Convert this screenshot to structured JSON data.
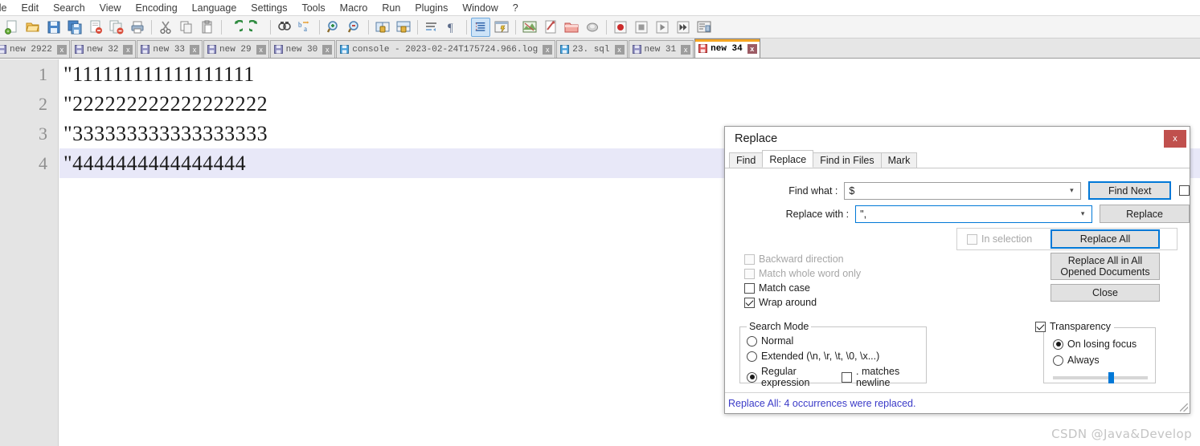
{
  "app": {
    "name": "Notepad++"
  },
  "menubar": {
    "items": [
      {
        "label": "ile"
      },
      {
        "label": "Edit"
      },
      {
        "label": "Search"
      },
      {
        "label": "View"
      },
      {
        "label": "Encoding"
      },
      {
        "label": "Language"
      },
      {
        "label": "Settings"
      },
      {
        "label": "Tools"
      },
      {
        "label": "Macro"
      },
      {
        "label": "Run"
      },
      {
        "label": "Plugins"
      },
      {
        "label": "Window"
      },
      {
        "label": "?"
      }
    ]
  },
  "toolbar": {
    "icons": [
      "new-file-icon",
      "open-file-icon",
      "save-icon",
      "save-all-icon",
      "close-file-icon",
      "close-all-files-icon",
      "print-icon",
      "cut-icon",
      "copy-icon",
      "paste-icon",
      "undo-icon",
      "redo-icon",
      "find-icon",
      "replace-icon",
      "zoom-in-icon",
      "zoom-out-icon",
      "sync-vertical-scroll-icon",
      "sync-horizontal-scroll-icon",
      "word-wrap-icon",
      "show-all-characters-icon",
      "indent-guide-icon",
      "user-defined-dialog-icon",
      "show-document-map-icon",
      "function-list-icon",
      "folder-as-workspace-icon",
      "monitoring-icon",
      "record-macro-icon",
      "stop-recording-icon",
      "play-macro-icon",
      "run-macro-multiple-icon",
      "run-icon"
    ]
  },
  "tabs": {
    "items": [
      {
        "label": "new 2922",
        "active": false
      },
      {
        "label": "new 32",
        "active": false
      },
      {
        "label": "new 33",
        "active": false
      },
      {
        "label": "new 29",
        "active": false
      },
      {
        "label": "new 30",
        "active": false
      },
      {
        "label": "console - 2023-02-24T175724.966.log",
        "active": false
      },
      {
        "label": "23. sql",
        "active": false
      },
      {
        "label": "new 31",
        "active": false
      },
      {
        "label": "new 34",
        "active": true
      }
    ],
    "close_glyph": "x"
  },
  "editor": {
    "lines": [
      {
        "number": "1",
        "text": "\"111111111111111111",
        "highlighted": false
      },
      {
        "number": "2",
        "text": "\"222222222222222222",
        "highlighted": false
      },
      {
        "number": "3",
        "text": "\"333333333333333333",
        "highlighted": false
      },
      {
        "number": "4",
        "text": "\"4444444444444444",
        "highlighted": true
      }
    ]
  },
  "dialog": {
    "title": "Replace",
    "close_label": "x",
    "tabs": [
      {
        "label": "Find",
        "active": false
      },
      {
        "label": "Replace",
        "active": true
      },
      {
        "label": "Find in Files",
        "active": false
      },
      {
        "label": "Mark",
        "active": false
      }
    ],
    "fields": {
      "find_what_label": "Find what :",
      "find_what_value": "$",
      "replace_with_label": "Replace with :",
      "replace_with_value": "\",",
      "arrow_glyph": "⌄"
    },
    "buttons": {
      "find_next": "Find Next",
      "replace": "Replace",
      "replace_all": "Replace All",
      "replace_all_opened": "Replace All in All Opened Documents",
      "close": "Close"
    },
    "in_selection": {
      "label": "In selection",
      "checked": false,
      "enabled": false
    },
    "options": [
      {
        "label": "Backward direction",
        "checked": false,
        "enabled": false
      },
      {
        "label": "Match whole word only",
        "checked": false,
        "enabled": false
      },
      {
        "label": "Match case",
        "checked": false,
        "enabled": true
      },
      {
        "label": "Wrap around",
        "checked": true,
        "enabled": true
      }
    ],
    "search_mode": {
      "legend": "Search Mode",
      "options": [
        {
          "label": "Normal",
          "selected": false
        },
        {
          "label": "Extended (\\n, \\r, \\t, \\0, \\x...)",
          "selected": false
        },
        {
          "label": "Regular expression",
          "selected": true
        }
      ],
      "dot_matches_newline": {
        "label": ". matches newline",
        "checked": false
      }
    },
    "transparency": {
      "label": "Transparency",
      "checked": true,
      "options": [
        {
          "label": "On losing focus",
          "selected": true
        },
        {
          "label": "Always",
          "selected": false
        }
      ],
      "slider_percent": 62
    },
    "status_message": "Replace All: 4 occurrences were replaced."
  },
  "watermark": {
    "text": "CSDN @Java&Develop"
  },
  "colors": {
    "accent_blue": "#0078d7",
    "status_text": "#3b3bc8",
    "active_tab_bar": "#f5a623",
    "close_button": "#c0504d",
    "gutter_bg": "#e4e4e4",
    "line_highlight": "#e8e8f8"
  }
}
